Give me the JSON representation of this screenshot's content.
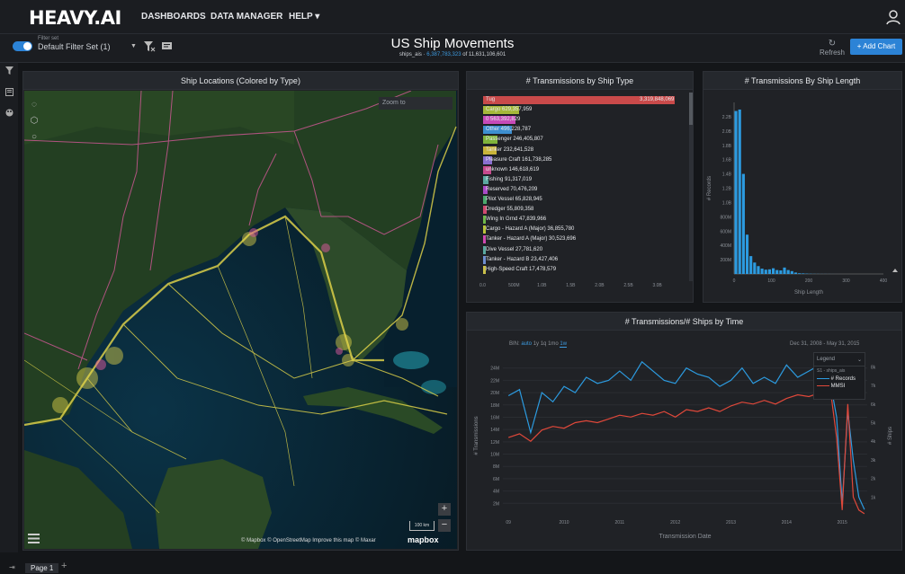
{
  "app": {
    "logo": "HEAVY.AI",
    "nav": [
      "DASHBOARDS",
      "DATA MANAGER",
      "HELP ▾"
    ]
  },
  "filter_set": {
    "label": "Filter set",
    "value": "Default Filter Set (1)"
  },
  "dashboard": {
    "title": "US Ship Movements",
    "table": "ships_ais",
    "filtered_count": "6,387,783,323",
    "of_text": "of 11,631,106,601"
  },
  "toolbar": {
    "refresh_label": "Refresh",
    "add_chart_label": "+ Add Chart"
  },
  "map_panel": {
    "title": "Ship Locations (Colored by Type)",
    "zoom_placeholder": "Zoom to",
    "attribution": "© Mapbox  © OpenStreetMap  Improve this map  © Maxar",
    "scale": "100 km",
    "logo": "mapbox"
  },
  "bar_panel": {
    "title": "# Transmissions by Ship Type",
    "chart_data": {
      "type": "bar",
      "orientation": "horizontal",
      "categories": [
        "Tug",
        "Cargo",
        "0",
        "Other",
        "Passenger",
        "Tanker",
        "Pleasure Craft",
        "unknown",
        "Fishing",
        "Reserved",
        "Pilot Vessel",
        "Dredger",
        "Wing In Grnd",
        "Cargo - Hazard A (Major)",
        "Tanker - Hazard A (Major)",
        "Dive Vessel",
        "Tanker - Hazard B",
        "High-Speed Craft"
      ],
      "values": [
        3319848069,
        629357959,
        563392829,
        496228787,
        246405807,
        232641528,
        161738285,
        146618619,
        91317019,
        70476209,
        65828945,
        55809358,
        47839966,
        36855780,
        30523696,
        27781620,
        23427406,
        17478579
      ],
      "value_labels": [
        "3,319,848,069",
        "629,357,959",
        "563,392,829",
        "496,228,787",
        "246,405,807",
        "232,641,528",
        "161,738,285",
        "146,618,619",
        "91,317,019",
        "70,476,209",
        "65,828,945",
        "55,809,358",
        "47,839,966",
        "36,855,780",
        "30,523,696",
        "27,781,620",
        "23,427,406",
        "17,478,579"
      ],
      "colors": [
        "#c94a4a",
        "#a5b83a",
        "#c64ab8",
        "#3d8fd0",
        "#7fb33a",
        "#c9b43a",
        "#8a6fd0",
        "#c64a8c",
        "#5aa9a0",
        "#a94ac6",
        "#4aa96c",
        "#d04a6f",
        "#6fb84a",
        "#b8c43a",
        "#d04ab1",
        "#5aa9a0",
        "#6f8fd0",
        "#c9c04a"
      ],
      "ticks": [
        "0.0",
        "500M",
        "1.0B",
        "1.5B",
        "2.0B",
        "2.5B",
        "3.0B"
      ],
      "xlim": [
        0,
        3500000000
      ]
    }
  },
  "hist_panel": {
    "title": "# Transmissions By Ship Length",
    "chart_data": {
      "type": "bar",
      "xlabel": "Ship Length",
      "ylabel": "# Records",
      "x": [
        5,
        15,
        25,
        35,
        45,
        55,
        65,
        75,
        85,
        95,
        105,
        115,
        125,
        135,
        145,
        155,
        165,
        175,
        185,
        195,
        205,
        215,
        225,
        235,
        245,
        255,
        265,
        275,
        285,
        295,
        305,
        315
      ],
      "values": [
        2280000000,
        2300000000,
        1400000000,
        550000000,
        250000000,
        160000000,
        110000000,
        75000000,
        60000000,
        65000000,
        80000000,
        55000000,
        50000000,
        90000000,
        55000000,
        40000000,
        20000000,
        10000000,
        8000000,
        5000000,
        3000000,
        2000000,
        1500000,
        1000000,
        1000000,
        800000,
        500000,
        300000,
        200000,
        100000,
        100000,
        50000
      ],
      "yticks": [
        "200M",
        "400M",
        "600M",
        "800M",
        "1.0B",
        "1.2B",
        "1.4B",
        "1.6B",
        "1.8B",
        "2.0B",
        "2.2B"
      ],
      "xticks": [
        "0",
        "100",
        "200",
        "300",
        "400"
      ],
      "xlim": [
        0,
        400
      ],
      "ylim": [
        0,
        2400000000
      ],
      "color": "#2c9be0"
    }
  },
  "line_panel": {
    "title": "# Transmissions/# Ships by Time",
    "bin_label": "BIN:",
    "bins": [
      "auto",
      "1y",
      "1q",
      "1mo",
      "1w"
    ],
    "date_range": "Dec 31, 2008 - May 31, 2015",
    "legend_title": "Legend",
    "legend_sub": "S1 - ships_ais",
    "chart_data": {
      "type": "line",
      "xlabel": "Transmission Date",
      "ylabel": "# Transmissions",
      "y2label": "# Ships",
      "xticks": [
        "09",
        "2010",
        "2011",
        "2012",
        "2013",
        "2014",
        "2015"
      ],
      "yticks": [
        "2M",
        "4M",
        "6M",
        "8M",
        "10M",
        "12M",
        "14M",
        "16M",
        "18M",
        "20M",
        "22M",
        "24M"
      ],
      "y2ticks": [
        "1k",
        "2k",
        "3k",
        "4k",
        "5k",
        "6k",
        "7k",
        "8k"
      ],
      "ylim": [
        0,
        26000000
      ],
      "y2lim": [
        0,
        8600
      ],
      "series": [
        {
          "name": "# Records",
          "color": "#2c9be0",
          "x": [
            2009.0,
            2009.2,
            2009.4,
            2009.6,
            2009.8,
            2010.0,
            2010.2,
            2010.4,
            2010.6,
            2010.8,
            2011.0,
            2011.2,
            2011.4,
            2011.6,
            2011.8,
            2012.0,
            2012.2,
            2012.4,
            2012.6,
            2012.8,
            2013.0,
            2013.2,
            2013.4,
            2013.6,
            2013.8,
            2014.0,
            2014.2,
            2014.4,
            2014.6,
            2014.8,
            2014.9,
            2015.0,
            2015.1,
            2015.2,
            2015.3,
            2015.4
          ],
          "values": [
            19500000,
            20500000,
            13500000,
            20000000,
            18500000,
            21000000,
            20000000,
            22500000,
            21500000,
            22000000,
            23500000,
            22000000,
            25000000,
            23500000,
            22000000,
            21500000,
            24000000,
            23000000,
            22500000,
            21000000,
            22000000,
            24000000,
            21500000,
            22500000,
            21500000,
            24500000,
            22500000,
            23500000,
            24500000,
            21000000,
            16000000,
            2000000,
            17000000,
            9000000,
            3000000,
            1000000
          ]
        },
        {
          "name": "MMSI",
          "color": "#e0483a",
          "x": [
            2009.0,
            2009.2,
            2009.4,
            2009.6,
            2009.8,
            2010.0,
            2010.2,
            2010.4,
            2010.6,
            2010.8,
            2011.0,
            2011.2,
            2011.4,
            2011.6,
            2011.8,
            2012.0,
            2012.2,
            2012.4,
            2012.6,
            2012.8,
            2013.0,
            2013.2,
            2013.4,
            2013.6,
            2013.8,
            2014.0,
            2014.2,
            2014.4,
            2014.6,
            2014.8,
            2014.9,
            2015.0,
            2015.1,
            2015.2,
            2015.3,
            2015.4
          ],
          "values": [
            4200,
            4400,
            4000,
            4600,
            4800,
            4700,
            5000,
            5100,
            5000,
            5200,
            5400,
            5300,
            5500,
            5400,
            5600,
            5300,
            5700,
            5600,
            5800,
            5600,
            5900,
            6100,
            6000,
            6200,
            6000,
            6300,
            6500,
            6400,
            6600,
            6500,
            4200,
            300,
            6000,
            1000,
            300,
            100
          ]
        }
      ]
    }
  }
}
